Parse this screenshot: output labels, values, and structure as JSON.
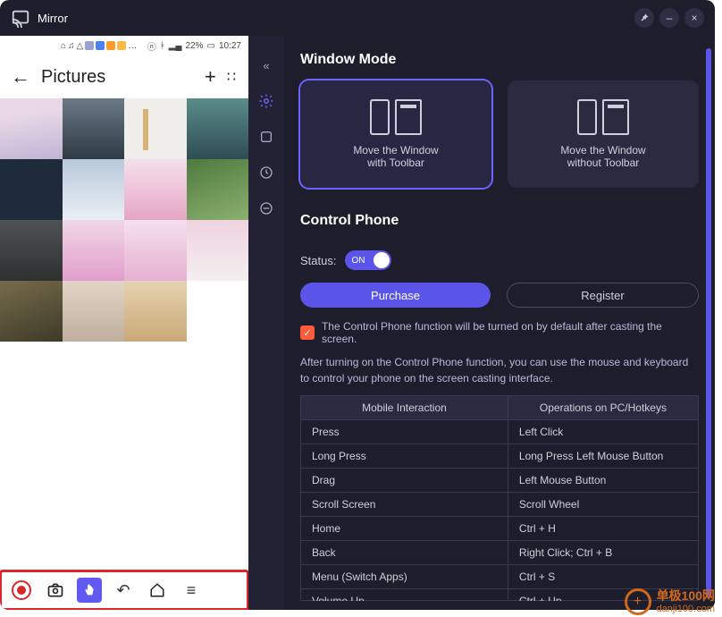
{
  "app": {
    "title": "Mirror"
  },
  "window_controls": {
    "pin": "⯑",
    "min": "–",
    "close": "×"
  },
  "phone": {
    "status": {
      "battery": "22%",
      "time": "10:27"
    },
    "header": {
      "title": "Pictures"
    },
    "toolbar": {
      "record": "record",
      "camera": "camera",
      "pointer": "pointer",
      "back": "back",
      "home": "home",
      "menu": "menu"
    }
  },
  "sidebar": {
    "items": [
      {
        "icon": "collapse"
      },
      {
        "icon": "settings"
      },
      {
        "icon": "crop"
      },
      {
        "icon": "history"
      },
      {
        "icon": "subtract"
      }
    ]
  },
  "main": {
    "section1_title": "Window Mode",
    "modes": [
      {
        "line1": "Move the Window",
        "line2": "with Toolbar"
      },
      {
        "line1": "Move the Window",
        "line2": "without Toolbar"
      }
    ],
    "section2_title": "Control Phone",
    "status_label": "Status:",
    "toggle_label": "ON",
    "buttons": {
      "purchase": "Purchase",
      "register": "Register"
    },
    "checkbox_text": "The Control Phone function will be turned on by default after casting the screen.",
    "description": "After turning on the Control Phone function, you can use the mouse and keyboard to control your phone on the screen casting interface.",
    "table": {
      "headers": {
        "c1": "Mobile Interaction",
        "c2": "Operations on PC/Hotkeys"
      },
      "rows": [
        {
          "c1": "Press",
          "c2": "Left Click"
        },
        {
          "c1": "Long Press",
          "c2": "Long Press Left Mouse Button"
        },
        {
          "c1": "Drag",
          "c2": "Left Mouse Button"
        },
        {
          "c1": "Scroll Screen",
          "c2": "Scroll Wheel"
        },
        {
          "c1": "Home",
          "c2": "Ctrl + H"
        },
        {
          "c1": "Back",
          "c2": "Right Click; Ctrl + B"
        },
        {
          "c1": "Menu (Switch Apps)",
          "c2": "Ctrl + S"
        },
        {
          "c1": "Volume Up",
          "c2": "Ctrl + Up"
        }
      ]
    }
  },
  "watermark": {
    "brand": "单极100网",
    "domain": "danji100.com"
  }
}
